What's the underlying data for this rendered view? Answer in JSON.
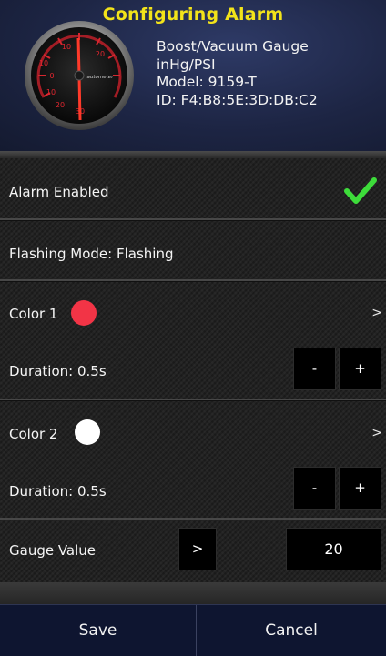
{
  "header": {
    "title": "Configuring Alarm",
    "device": {
      "name": "Boost/Vacuum Gauge",
      "units": "inHg/PSI",
      "model": "Model: 9159-T",
      "id": "ID: F4:B8:5E:3D:DB:C2"
    },
    "gauge_ticks": [
      "10",
      "20",
      "0",
      "10",
      "20",
      "30",
      "10"
    ],
    "gauge_brand": "autometer"
  },
  "alarm_enabled": {
    "label": "Alarm Enabled",
    "checked": true,
    "check_color": "#3ddc3a"
  },
  "flashing_mode": {
    "label": "Flashing Mode: Flashing"
  },
  "color1": {
    "label": "Color 1",
    "swatch": "#f23446",
    "chevron": ">"
  },
  "duration1": {
    "label": "Duration: 0.5s",
    "minus": "-",
    "plus": "+"
  },
  "color2": {
    "label": "Color 2",
    "swatch": "#ffffff",
    "chevron": ">"
  },
  "duration2": {
    "label": "Duration: 0.5s",
    "minus": "-",
    "plus": "+"
  },
  "gauge_value": {
    "label": "Gauge Value",
    "toggle": ">",
    "value": "20"
  },
  "footer": {
    "save": "Save",
    "cancel": "Cancel"
  },
  "colors": {
    "title": "#f2e31a",
    "footer_bg": "#0e1530"
  }
}
